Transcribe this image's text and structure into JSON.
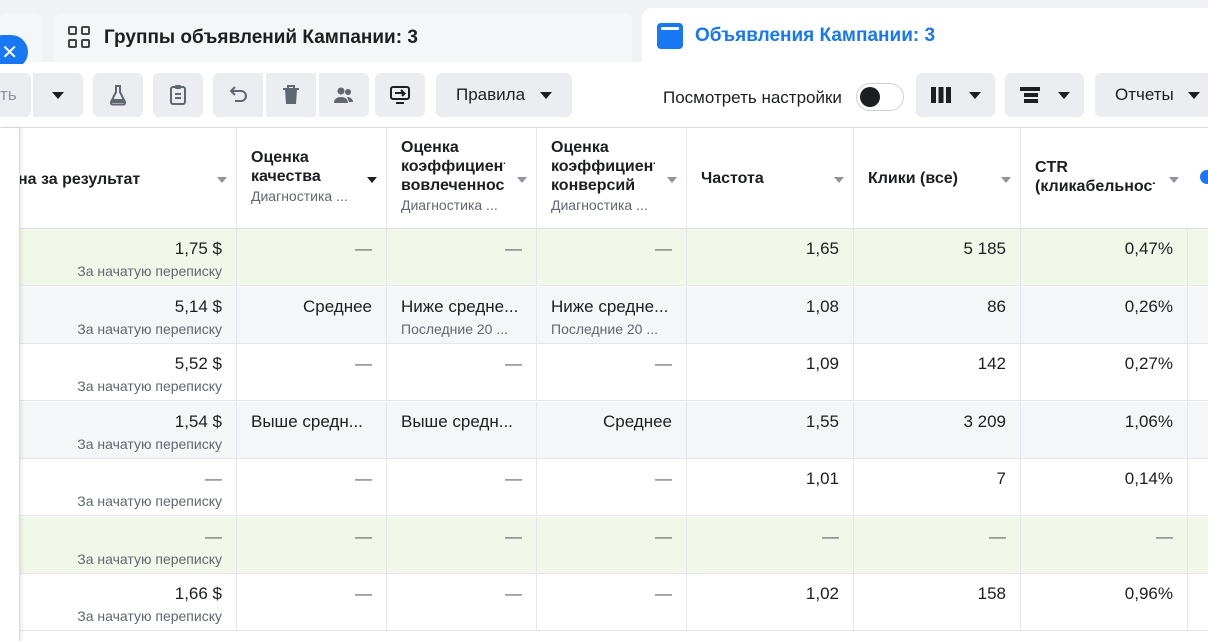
{
  "tabs": {
    "close_glyph": "✕",
    "groups_title": "Группы объявлений Кампании: 3",
    "ads_title": "Объявления Кампании: 3"
  },
  "toolbar": {
    "partial_label": "ть",
    "rules_label": "Правила",
    "view_settings_label": "Посмотреть настройки",
    "reports_label": "Отчеты",
    "view_settings_on": false
  },
  "columns": [
    {
      "name": "на за результат",
      "sub": ""
    },
    {
      "name": "Оценка качества",
      "sub": "Диагностика ..."
    },
    {
      "name": "Оценка коэффициент вовлеченности",
      "sub": "Диагностика ..."
    },
    {
      "name": "Оценка коэффициент конверсий",
      "sub": "Диагностика ..."
    },
    {
      "name": "Частота",
      "sub": ""
    },
    {
      "name": "Клики (все)",
      "sub": ""
    },
    {
      "name": "CTR (кликабельность)",
      "sub": ""
    }
  ],
  "rows": [
    {
      "cost": "1,75 $",
      "cost_sub": "За начатую переписку",
      "quality": "—",
      "quality_sub": "",
      "engagement": "—",
      "engagement_sub": "",
      "conversion": "—",
      "conversion_sub": "",
      "frequency": "1,65",
      "clicks": "5 185",
      "ctr": "0,47%"
    },
    {
      "cost": "5,14 $",
      "cost_sub": "За начатую переписку",
      "quality": "Среднее",
      "quality_sub": "",
      "engagement": "Ниже средне...",
      "engagement_sub": "Последние 20 ...",
      "conversion": "Ниже средне...",
      "conversion_sub": "Последние 20 ...",
      "frequency": "1,08",
      "clicks": "86",
      "ctr": "0,26%"
    },
    {
      "cost": "5,52 $",
      "cost_sub": "За начатую переписку",
      "quality": "—",
      "quality_sub": "",
      "engagement": "—",
      "engagement_sub": "",
      "conversion": "—",
      "conversion_sub": "",
      "frequency": "1,09",
      "clicks": "142",
      "ctr": "0,27%"
    },
    {
      "cost": "1,54 $",
      "cost_sub": "За начатую переписку",
      "quality": "Выше средн...",
      "quality_sub": "",
      "engagement": "Выше средн...",
      "engagement_sub": "",
      "conversion": "Среднее",
      "conversion_sub": "",
      "frequency": "1,55",
      "clicks": "3 209",
      "ctr": "1,06%"
    },
    {
      "cost": "—",
      "cost_sub": "За начатую переписку",
      "quality": "—",
      "quality_sub": "",
      "engagement": "—",
      "engagement_sub": "",
      "conversion": "—",
      "conversion_sub": "",
      "frequency": "1,01",
      "clicks": "7",
      "ctr": "0,14%"
    },
    {
      "cost": "—",
      "cost_sub": "За начатую переписку",
      "quality": "—",
      "quality_sub": "",
      "engagement": "—",
      "engagement_sub": "",
      "conversion": "—",
      "conversion_sub": "",
      "frequency": "—",
      "clicks": "—",
      "ctr": "—"
    },
    {
      "cost": "1,66 $",
      "cost_sub": "За начатую переписку",
      "quality": "—",
      "quality_sub": "",
      "engagement": "—",
      "engagement_sub": "",
      "conversion": "—",
      "conversion_sub": "",
      "frequency": "1,02",
      "clicks": "158",
      "ctr": "0,96%"
    }
  ],
  "colors": {
    "accent": "#1877f2",
    "row_highlight": "#f1f8e9",
    "row_alt": "#f5f6f7",
    "text": "#1c1e21",
    "muted": "#606770"
  }
}
